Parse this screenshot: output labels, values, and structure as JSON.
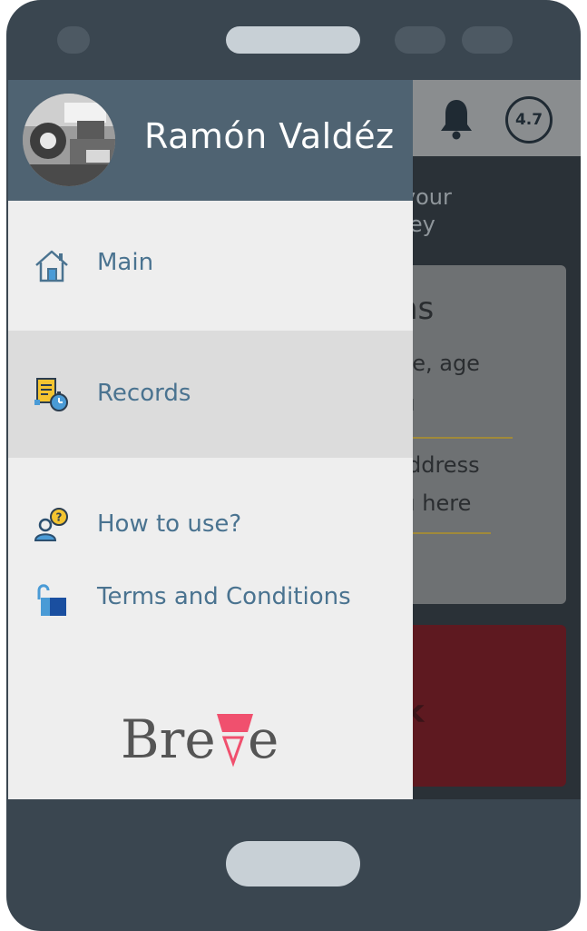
{
  "user": {
    "name": "Ramón Valdéz"
  },
  "header": {
    "rating": "4.7"
  },
  "menu": {
    "items": [
      {
        "label": "Main",
        "icon": "home-icon"
      },
      {
        "label": "Records",
        "icon": "records-timer-icon",
        "active": true
      },
      {
        "label": "How to use?",
        "icon": "help-person-icon"
      },
      {
        "label": "Terms and Conditions",
        "icon": "unlocked-padlock-icon"
      }
    ]
  },
  "background": {
    "subtitle": "d your\noney",
    "card": {
      "title": "ns",
      "line1": "ne, age",
      "line2": "ı",
      "line3": "ddress",
      "line4": "ı here"
    },
    "button_text": "k"
  },
  "logo": {
    "text": "Breve"
  },
  "colors": {
    "drawer_header": "#4f6372",
    "drawer_bg": "#eeeeee",
    "active_item": "#dcdcdc",
    "menu_text": "#4a7390",
    "phone_frame": "#3a4650",
    "accent_pink": "#f0506e"
  }
}
